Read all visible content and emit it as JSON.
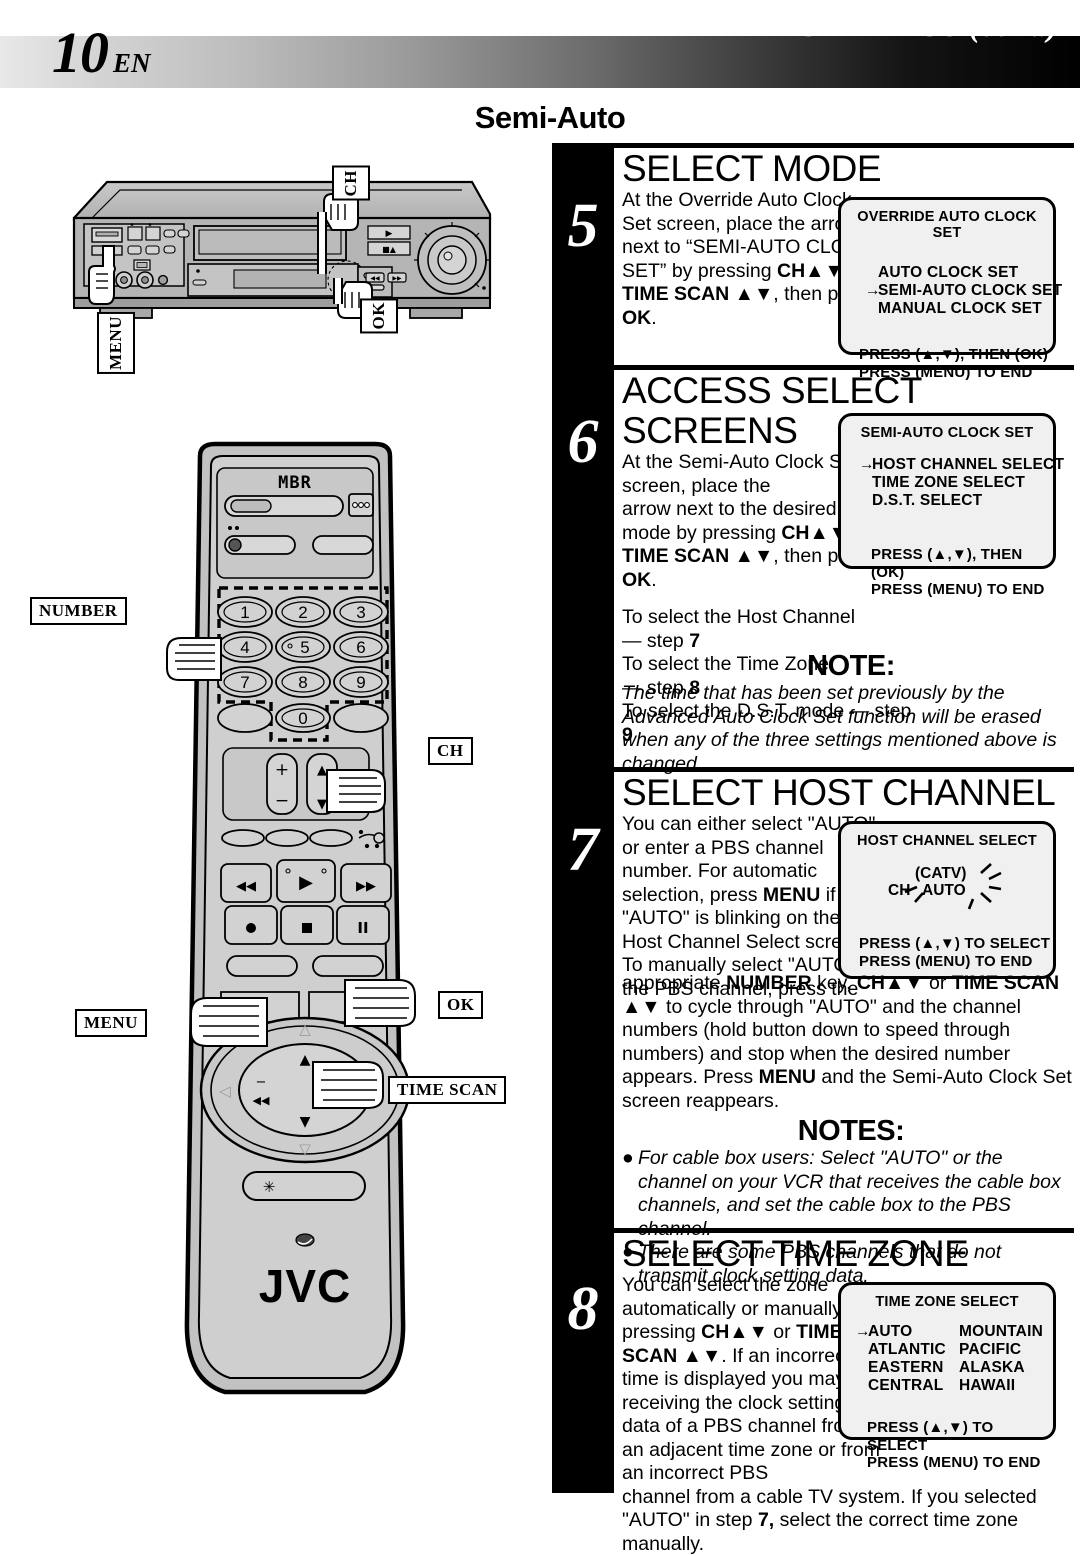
{
  "header": {
    "page_number": "10",
    "language_code": "EN",
    "title": "INITIAL SETTINGS (cont.)",
    "subtitle": "Semi-Auto"
  },
  "illustrations": {
    "vcr": {
      "name": "vcr-front-panel",
      "callouts": [
        {
          "label": "CH",
          "name": "callout-ch-vcr"
        },
        {
          "label": "OK",
          "name": "callout-ok-vcr"
        },
        {
          "label": "MENU",
          "name": "callout-menu-vcr"
        }
      ]
    },
    "remote": {
      "name": "remote-control",
      "brand": "JVC",
      "model_mark": "MBR",
      "keypad_digits": [
        "1",
        "2",
        "3",
        "4",
        "5",
        "6",
        "7",
        "8",
        "9",
        "0"
      ],
      "callouts": [
        {
          "label": "NUMBER",
          "name": "callout-number"
        },
        {
          "label": "CH",
          "name": "callout-ch-remote"
        },
        {
          "label": "MENU",
          "name": "callout-menu-remote"
        },
        {
          "label": "OK",
          "name": "callout-ok-remote"
        },
        {
          "label": "TIME SCAN",
          "name": "callout-time-scan"
        }
      ]
    }
  },
  "steps": [
    {
      "number": "5",
      "heading": "SELECT MODE",
      "body_html": "At the Override Auto Clock Set screen, place the arrow next to “SEMI-AUTO CLOCK SET” by pressing <b>CH▲▼</b> or <b>TIME SCAN ▲▼</b>, then press <b>OK</b>.",
      "osd": {
        "title": "OVERRIDE AUTO CLOCK SET",
        "items": [
          {
            "arrow": false,
            "text": "AUTO CLOCK SET"
          },
          {
            "arrow": true,
            "text": "SEMI-AUTO CLOCK SET"
          },
          {
            "arrow": false,
            "text": "MANUAL CLOCK SET"
          }
        ],
        "footer": [
          "PRESS (▲,▼), THEN (OK)",
          "PRESS (MENU) TO END"
        ]
      }
    },
    {
      "number": "6",
      "heading": "ACCESS SELECT SCREENS",
      "body_html": "At the Semi-Auto Clock Set screen, place the<br>arrow next to the desired mode by pressing <b>CH▲▼</b> or <b>TIME SCAN ▲▼</b>, then press <b>OK</b>.",
      "body_extra_html": "To select the Host Channel<br>— step <b>7</b><br>To select the Time Zone<br>— step <b>8</b><br>To select the D.S.T. mode — step <b>9</b>",
      "osd": {
        "title": "SEMI-AUTO CLOCK SET",
        "items": [
          {
            "arrow": true,
            "text": "HOST CHANNEL SELECT"
          },
          {
            "arrow": false,
            "text": "TIME ZONE SELECT"
          },
          {
            "arrow": false,
            "text": "D.S.T. SELECT"
          }
        ],
        "footer": [
          "PRESS (▲,▼), THEN (OK)",
          "PRESS (MENU) TO END"
        ]
      }
    },
    {
      "number": "7",
      "heading": "SELECT HOST CHANNEL",
      "body_html": "You can either select \"AUTO\", or enter a PBS channel number. For automatic selection, press <b>MENU</b> if \"AUTO\" is blinking on the Host Channel Select screen. To manually select \"AUTO\" or the PBS channel, press the",
      "body_wide_html": "appropriate <b>NUMBER</b> key, <b>CH▲▼</b> or <b>TIME SCAN ▲▼</b> to cycle through \"AUTO\" and the channel numbers (hold button down to speed through numbers) and stop when the desired number appears. Press <b>MENU</b> and the Semi-Auto Clock Set screen reappears.",
      "osd": {
        "title": "HOST CHANNEL SELECT",
        "display_catv": "(CATV)",
        "display_ch": "CH",
        "display_value": "AUTO",
        "footer": [
          "PRESS (▲,▼) TO SELECT",
          "PRESS (MENU) TO END"
        ]
      }
    },
    {
      "number": "8",
      "heading": "SELECT TIME ZONE",
      "body_html": "You can select the zone automatically or manually by pressing <b>CH▲▼</b> or <b>TIME SCAN ▲▼</b>. If an incorrect time is displayed you may be receiving the clock setting data of a PBS channel from an adjacent time zone or from an incorrect PBS",
      "body_wide_html": "channel from a cable TV system. If you selected \"AUTO\" in step <b>7,</b> select the correct time zone manually.",
      "osd": {
        "title": "TIME ZONE SELECT",
        "columns": [
          [
            {
              "arrow": true,
              "text": "AUTO"
            },
            {
              "arrow": false,
              "text": "ATLANTIC"
            },
            {
              "arrow": false,
              "text": "EASTERN"
            },
            {
              "arrow": false,
              "text": "CENTRAL"
            }
          ],
          [
            {
              "arrow": false,
              "text": "MOUNTAIN"
            },
            {
              "arrow": false,
              "text": "PACIFIC"
            },
            {
              "arrow": false,
              "text": "ALASKA"
            },
            {
              "arrow": false,
              "text": "HAWAII"
            }
          ]
        ],
        "footer": [
          "PRESS (▲,▼) TO SELECT",
          "PRESS (MENU) TO END"
        ]
      }
    }
  ],
  "notes": [
    {
      "id": "note-step6",
      "heading": "NOTE:",
      "centered": true,
      "body_html": "The time that has been set previously by the Advanced Auto Clock Set function will be erased when any of the three settings mentioned above is changed."
    },
    {
      "id": "notes-step7",
      "heading": "NOTES:",
      "centered": true,
      "bullets": [
        "For cable box users:  Select \"AUTO\" or the channel on your VCR that receives the cable box channels, and set the cable box to the PBS channel.",
        "There are some PBS channels that do not transmit clock setting data."
      ]
    }
  ],
  "colors": {
    "ink": "#000000",
    "osd_bg": "#f0f0f0",
    "device_body": "#b5b5b5",
    "device_light": "#d2d2d2"
  }
}
